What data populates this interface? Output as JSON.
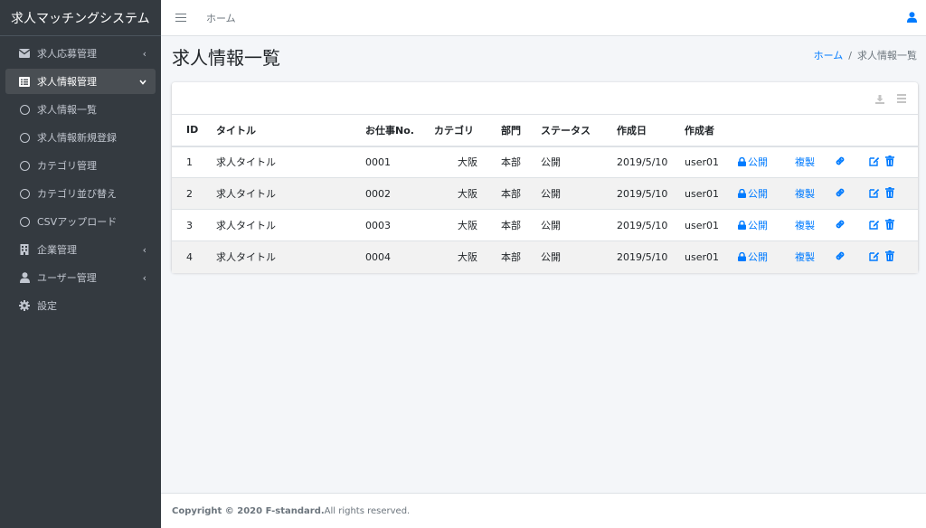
{
  "app": {
    "title": "求人マッチングシステム"
  },
  "sidebar": {
    "items": [
      {
        "label": "求人応募管理",
        "icon": "envelope-icon",
        "arrow": "‹"
      },
      {
        "label": "求人情報管理",
        "icon": "list-icon",
        "arrow": "⌄"
      },
      {
        "label": "求人情報一覧",
        "icon": "circle-icon"
      },
      {
        "label": "求人情報新規登録",
        "icon": "circle-icon"
      },
      {
        "label": "カテゴリ管理",
        "icon": "circle-icon"
      },
      {
        "label": "カテゴリ並び替え",
        "icon": "circle-icon"
      },
      {
        "label": "CSVアップロード",
        "icon": "circle-icon"
      },
      {
        "label": "企業管理",
        "icon": "building-icon",
        "arrow": "‹"
      },
      {
        "label": "ユーザー管理",
        "icon": "user-icon",
        "arrow": "‹"
      },
      {
        "label": "設定",
        "icon": "gear-icon"
      }
    ]
  },
  "topbar": {
    "home": "ホーム"
  },
  "page": {
    "title": "求人情報一覧"
  },
  "breadcrumb": {
    "home": "ホーム",
    "sep": "/",
    "current": "求人情報一覧"
  },
  "table": {
    "headers": [
      "ID",
      "タイトル",
      "お仕事No.",
      "カテゴリ",
      "部門",
      "ステータス",
      "作成日",
      "作成者"
    ],
    "rows": [
      {
        "id": "1",
        "title": "求人タイトル",
        "no": "0001",
        "category": "大阪",
        "dept": "本部",
        "status": "公開",
        "date": "2019/5/10",
        "author": "user01",
        "publish": "公開",
        "copy": "複製"
      },
      {
        "id": "2",
        "title": "求人タイトル",
        "no": "0002",
        "category": "大阪",
        "dept": "本部",
        "status": "公開",
        "date": "2019/5/10",
        "author": "user01",
        "publish": "公開",
        "copy": "複製"
      },
      {
        "id": "3",
        "title": "求人タイトル",
        "no": "0003",
        "category": "大阪",
        "dept": "本部",
        "status": "公開",
        "date": "2019/5/10",
        "author": "user01",
        "publish": "公開",
        "copy": "複製"
      },
      {
        "id": "4",
        "title": "求人タイトル",
        "no": "0004",
        "category": "大阪",
        "dept": "本部",
        "status": "公開",
        "date": "2019/5/10",
        "author": "user01",
        "publish": "公開",
        "copy": "複製"
      }
    ]
  },
  "footer": {
    "copyright": "Copyright © 2020 F-standard.",
    "rights": " All rights reserved."
  },
  "colors": {
    "sidebar": "#343a40",
    "accent": "#007bff"
  }
}
